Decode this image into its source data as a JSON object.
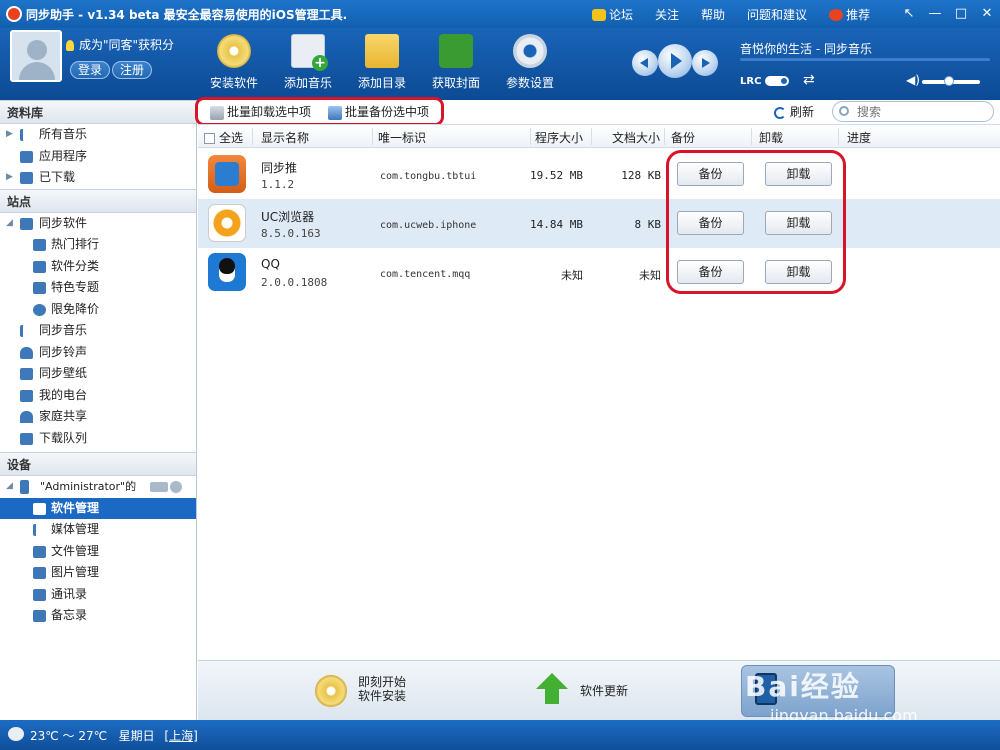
{
  "window": {
    "title": "同步助手 - v1.34 beta  最安全最容易使用的iOS管理工具.",
    "links": [
      {
        "label": "论坛"
      },
      {
        "label": "关注"
      },
      {
        "label": "帮助"
      },
      {
        "label": "问题和建议"
      },
      {
        "label": "推荐"
      }
    ],
    "controls": [
      "↖",
      "—",
      "□",
      "✕"
    ]
  },
  "user": {
    "guest_text": "成为\"同客\"获积分",
    "login_label": "登录",
    "register_label": "注册"
  },
  "toolbar": {
    "tools": [
      {
        "label": "安装软件",
        "icon": "disc-install-icon"
      },
      {
        "label": "添加音乐",
        "icon": "add-music-icon"
      },
      {
        "label": "添加目录",
        "icon": "add-folder-icon"
      },
      {
        "label": "获取封面",
        "icon": "get-cover-icon"
      },
      {
        "label": "参数设置",
        "icon": "gear-icon"
      }
    ]
  },
  "player": {
    "song_title": "音悦你的生活 - 同步音乐",
    "lrc_label": "LRC",
    "shuffle_glyph": "⇄",
    "volume_glyph": "◀)",
    "volume_level": 0.38
  },
  "sidebar": {
    "library_header": "资料库",
    "library_items": [
      {
        "label": "所有音乐"
      },
      {
        "label": "应用程序"
      },
      {
        "label": "已下载"
      }
    ],
    "site_header": "站点",
    "site_items": [
      {
        "label": "同步软件"
      },
      {
        "label": "热门排行"
      },
      {
        "label": "软件分类"
      },
      {
        "label": "特色专题"
      },
      {
        "label": "限免降价"
      },
      {
        "label": "同步音乐"
      },
      {
        "label": "同步铃声"
      },
      {
        "label": "同步壁纸"
      },
      {
        "label": "我的电台"
      },
      {
        "label": "家庭共享"
      },
      {
        "label": "下载队列"
      }
    ],
    "device_header": "设备",
    "device_name": "\"Administrator\"的",
    "device_items": [
      {
        "label": "软件管理"
      },
      {
        "label": "媒体管理"
      },
      {
        "label": "文件管理"
      },
      {
        "label": "图片管理"
      },
      {
        "label": "通讯录"
      },
      {
        "label": "备忘录"
      }
    ]
  },
  "actions": {
    "batch_uninstall": "批量卸载选中项",
    "batch_backup": "批量备份选中项",
    "refresh": "刷新",
    "search_placeholder": "搜索"
  },
  "table": {
    "columns": {
      "select_all": "全选",
      "name": "显示名称",
      "id": "唯一标识",
      "app_size": "程序大小",
      "doc_size": "文档大小",
      "backup": "备份",
      "uninstall": "卸载",
      "progress": "进度"
    },
    "rows": [
      {
        "name": "同步推",
        "version": "1.1.2",
        "id": "com.tongbu.tbtui",
        "app_size": "19.52 MB",
        "doc_size": "128 KB",
        "backup": "备份",
        "uninstall": "卸载"
      },
      {
        "name": "UC浏览器",
        "version": "8.5.0.163",
        "id": "com.ucweb.iphone",
        "app_size": "14.84 MB",
        "doc_size": "8 KB",
        "backup": "备份",
        "uninstall": "卸载"
      },
      {
        "name": "QQ",
        "version": "2.0.0.1808",
        "id": "com.tencent.mqq",
        "app_size": "未知",
        "doc_size": "未知",
        "backup": "备份",
        "uninstall": "卸载"
      }
    ]
  },
  "bottom": {
    "start_install_line1": "即刻开始",
    "start_install_line2": "软件安装",
    "software_update": "软件更新",
    "watermark": "Bai经验",
    "watermark_url": "jingyan.baidu.com"
  },
  "status": {
    "temperature": "23℃ ～ 27℃",
    "weekday": "星期日",
    "city": "[上海]"
  },
  "colors": {
    "brand_blue": "#1a64b8",
    "selected_blue": "#1c69c4",
    "highlight_red": "#d8142a",
    "row_alt": "#dfeaf7"
  }
}
